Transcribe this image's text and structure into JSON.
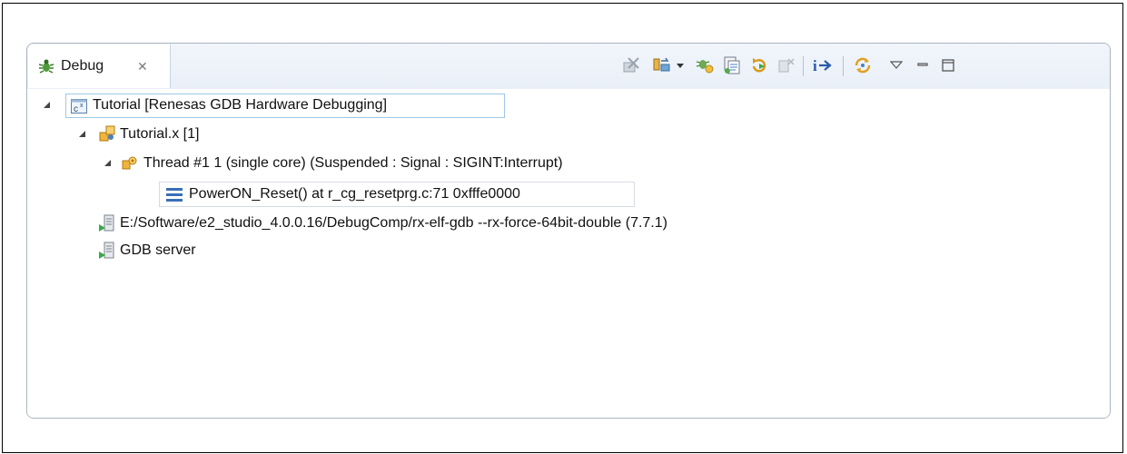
{
  "view": {
    "tab_label": "Debug",
    "tab_close_glyph": "✕",
    "tab_icon": "debug-bug-icon"
  },
  "toolbar": {
    "buttons": [
      {
        "name": "remove-all-terminated-icon"
      },
      {
        "name": "connect-icon"
      },
      {
        "name": "dropdown-arrow-icon"
      },
      {
        "name": "hardware-breakpoint-icon"
      },
      {
        "name": "copy-stack-icon"
      },
      {
        "name": "restart-icon"
      },
      {
        "name": "disabled-icon"
      },
      {
        "name": "instruction-stepping-mode-icon"
      },
      {
        "name": "sync-refresh-icon"
      },
      {
        "name": "view-menu-icon"
      },
      {
        "name": "minimize-icon"
      },
      {
        "name": "maximize-icon"
      }
    ]
  },
  "tree": {
    "launch": "Tutorial [Renesas GDB Hardware Debugging]",
    "process": "Tutorial.x [1]",
    "thread": "Thread #1 1 (single core) (Suspended : Signal : SIGINT:Interrupt)",
    "frame": "PowerON_Reset() at r_cg_resetprg.c:71 0xfffe0000",
    "gdb_process": "E:/Software/e2_studio_4.0.0.16/DebugComp/rx-elf-gdb --rx-force-64bit-double (7.7.1)",
    "gdb_server": "GDB server"
  },
  "colors": {
    "border": "#aab4c2",
    "selection": "#9ec8e8",
    "header_bg": "#eaf0f8"
  }
}
